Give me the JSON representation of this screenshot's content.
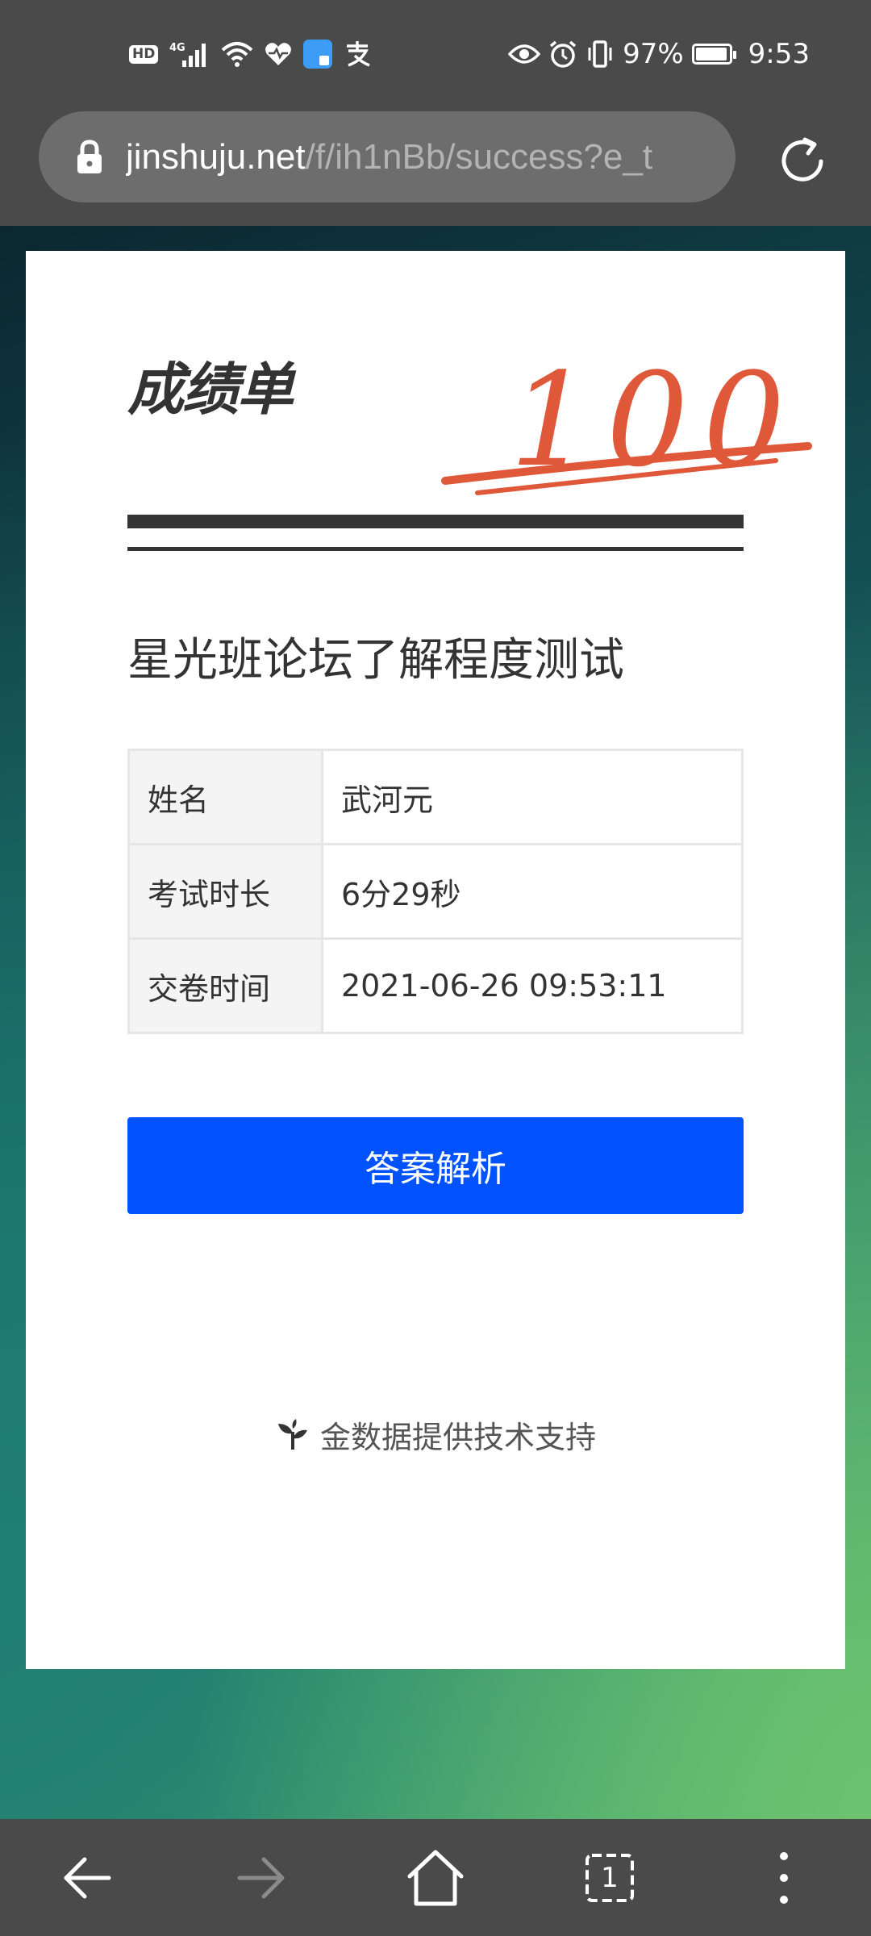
{
  "status_bar": {
    "hd": "HD",
    "network": "4G",
    "battery_percent": "97%",
    "battery_level": 0.97,
    "time": "9:53",
    "icons": [
      "hd-icon",
      "signal-4g-icon",
      "wifi-icon",
      "health-icon",
      "app-badge-icon",
      "alipay-icon",
      "eye-icon",
      "alarm-icon",
      "vibrate-icon",
      "battery-icon"
    ]
  },
  "browser": {
    "url_domain": "jinshuju.net",
    "url_path": "/f/ih1nBb/success?e_t",
    "tab_count": "1"
  },
  "report": {
    "title": "成绩单",
    "score": "100",
    "score_color": "#e0583a",
    "exam_title": "星光班论坛了解程度测试",
    "rows": [
      {
        "label": "姓名",
        "value": "武河元"
      },
      {
        "label": "考试时长",
        "value": "6分29秒"
      },
      {
        "label": "交卷时间",
        "value": "2021-06-26 09:53:11"
      }
    ],
    "answer_button": "答案解析",
    "button_color": "#0052ff",
    "powered_by": "金数据提供技术支持"
  }
}
